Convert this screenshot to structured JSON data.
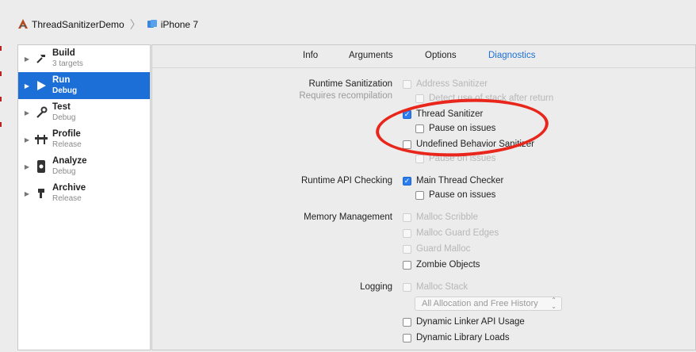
{
  "breadcrumb": {
    "project": "ThreadSanitizerDemo",
    "device": "iPhone 7"
  },
  "sidebar": {
    "items": [
      {
        "label": "Build",
        "sub": "3 targets",
        "icon": "hammer-icon"
      },
      {
        "label": "Run",
        "sub": "Debug",
        "icon": "play-icon"
      },
      {
        "label": "Test",
        "sub": "Debug",
        "icon": "wrench-icon"
      },
      {
        "label": "Profile",
        "sub": "Release",
        "icon": "instruments-icon"
      },
      {
        "label": "Analyze",
        "sub": "Debug",
        "icon": "analyze-icon"
      },
      {
        "label": "Archive",
        "sub": "Release",
        "icon": "archive-icon"
      }
    ],
    "selected": "Run"
  },
  "tabs": [
    "Info",
    "Arguments",
    "Options",
    "Diagnostics"
  ],
  "active_tab": "Diagnostics",
  "sections": {
    "runtime_sanitization": {
      "label": "Runtime Sanitization",
      "sublabel": "Requires recompilation",
      "address_sanitizer": "Address Sanitizer",
      "detect_stack": "Detect use of stack after return",
      "thread_sanitizer": "Thread Sanitizer",
      "pause_on_issues_1": "Pause on issues",
      "undefined_behavior": "Undefined Behavior Sanitizer",
      "pause_on_issues_2": "Pause on issues"
    },
    "runtime_api": {
      "label": "Runtime API Checking",
      "main_thread_checker": "Main Thread Checker",
      "pause_on_issues": "Pause on issues"
    },
    "memory": {
      "label": "Memory Management",
      "malloc_scribble": "Malloc Scribble",
      "malloc_guard_edges": "Malloc Guard Edges",
      "guard_malloc": "Guard Malloc",
      "zombie_objects": "Zombie Objects"
    },
    "logging": {
      "label": "Logging",
      "malloc_stack": "Malloc Stack",
      "allocation_select": "All Allocation and Free History",
      "dynamic_linker": "Dynamic Linker API Usage",
      "dynamic_library_loads": "Dynamic Library Loads"
    }
  },
  "colors": {
    "accent": "#1b6fd6",
    "annotation": "#e8261b"
  }
}
